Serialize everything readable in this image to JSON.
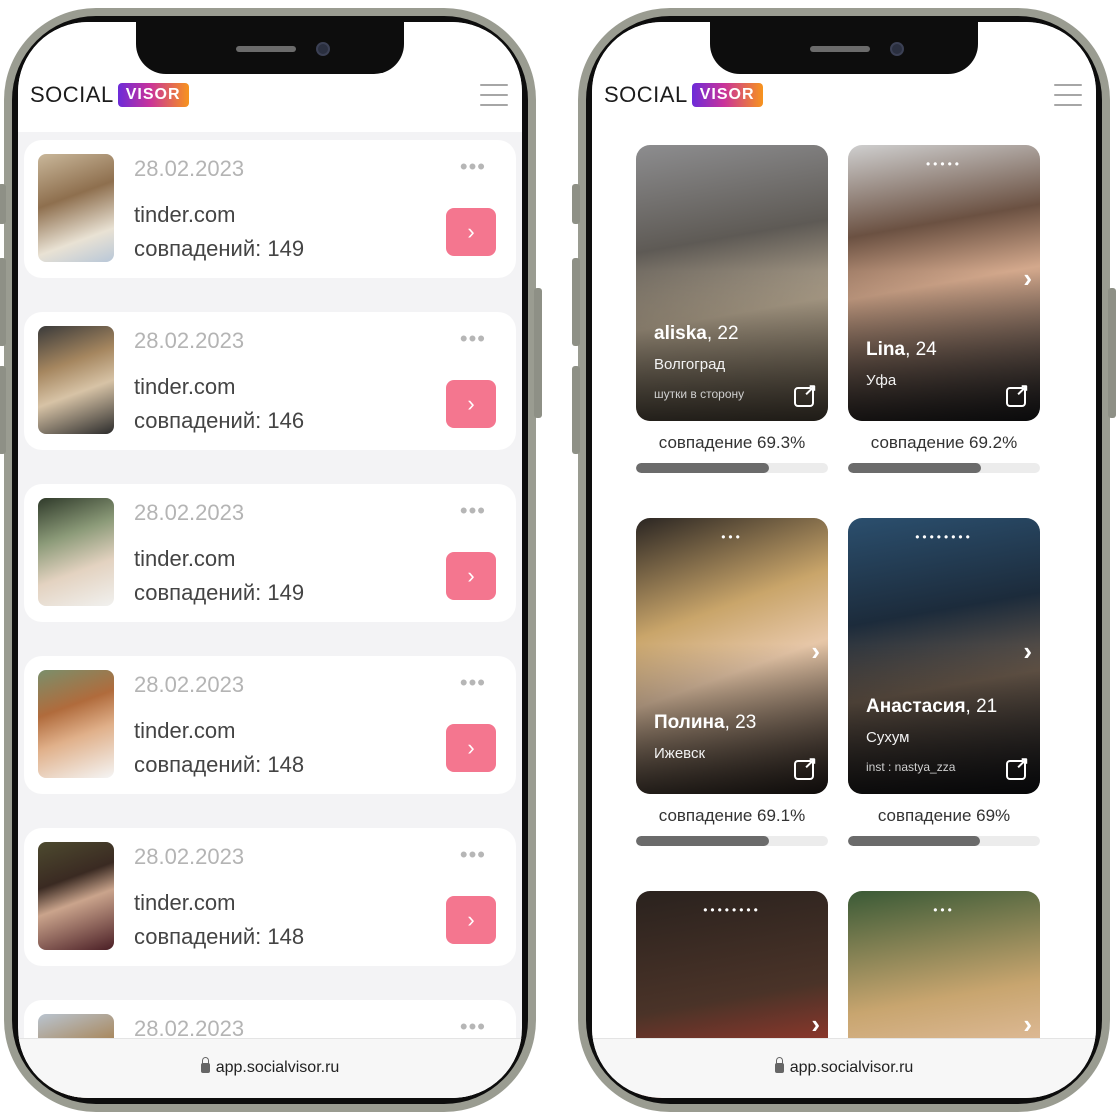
{
  "brand": {
    "word1": "SOCIAL",
    "word2": "VISOR"
  },
  "browser": {
    "url": "app.socialvisor.ru"
  },
  "results": [
    {
      "date": "28.02.2023",
      "site": "tinder.com",
      "matches": "совпадений: 149"
    },
    {
      "date": "28.02.2023",
      "site": "tinder.com",
      "matches": "совпадений: 146"
    },
    {
      "date": "28.02.2023",
      "site": "tinder.com",
      "matches": "совпадений: 149"
    },
    {
      "date": "28.02.2023",
      "site": "tinder.com",
      "matches": "совпадений: 148"
    },
    {
      "date": "28.02.2023",
      "site": "tinder.com",
      "matches": "совпадений: 148"
    },
    {
      "date": "28.02.2023"
    }
  ],
  "menu_dots": "•••",
  "open_arrow": "›",
  "profiles": [
    {
      "name": "aliska",
      "age": ", 22",
      "city": "Волгоград",
      "note": "шутки в сторону",
      "match": "совпадение 69.3%",
      "match_value": 0.693,
      "photo_dots": ""
    },
    {
      "name": "Lina",
      "age": ", 24",
      "city": "Уфа",
      "note": "",
      "match": "совпадение 69.2%",
      "match_value": 0.692,
      "photo_dots": "•••••"
    },
    {
      "name": "Полина",
      "age": ", 23",
      "city": "Ижевск",
      "note": "",
      "match": "совпадение 69.1%",
      "match_value": 0.691,
      "photo_dots": "•••"
    },
    {
      "name": "Анастасия",
      "age": ", 21",
      "city": "Сухум",
      "note": "inst : nastya_zza",
      "match": "совпадение 69%",
      "match_value": 0.69,
      "photo_dots": "••••••••"
    },
    {
      "name": "",
      "age": "",
      "city": "",
      "note": "",
      "match": "",
      "photo_dots": "••••••••"
    },
    {
      "name": "",
      "age": "",
      "city": "",
      "note": "",
      "match": "",
      "photo_dots": "•••"
    }
  ],
  "photo_arrow": "›"
}
